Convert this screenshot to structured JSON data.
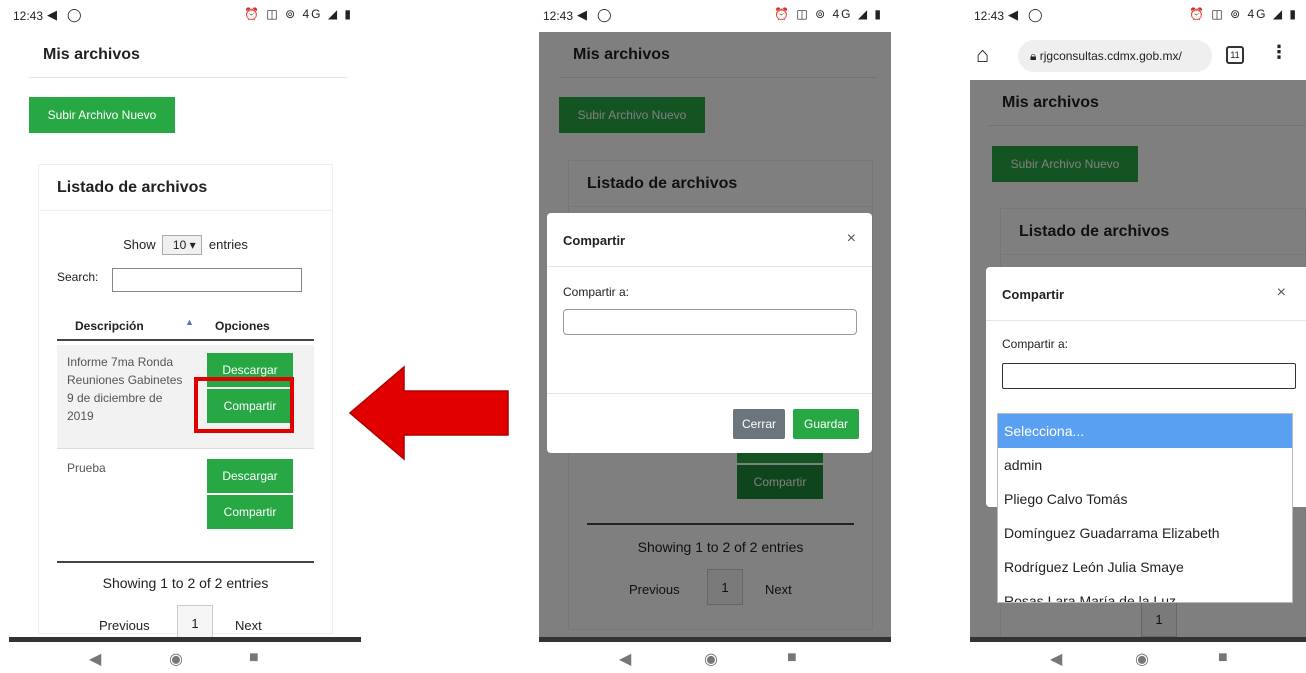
{
  "status": {
    "time": "12:43",
    "icons_right": "⏰ ◫ ⊚ 4G ◢ ▮"
  },
  "page": {
    "title": "Mis archivos",
    "upload_button": "Subir Archivo Nuevo",
    "list_title": "Listado de archivos",
    "show_label": "Show",
    "entries_value": "10 ▾",
    "entries_label": "entries",
    "search_label": "Search:",
    "columns": [
      "Descripción",
      "Opciones"
    ],
    "rows": [
      {
        "description": "Informe 7ma Ronda Reuniones Gabinetes 9 de diciembre de 2019",
        "download": "Descargar",
        "share": "Compartir"
      },
      {
        "description": "Prueba",
        "download": "Descargar",
        "share": "Compartir"
      }
    ],
    "showing": "Showing 1 to 2 of 2 entries",
    "pager": {
      "previous": "Previous",
      "current": "1",
      "next": "Next"
    }
  },
  "modal": {
    "title": "Compartir",
    "close": "×",
    "field_label": "Compartir a:",
    "cancel": "Cerrar",
    "save": "Guardar"
  },
  "browser": {
    "url": "rjgconsultas.cdmx.gob.mx/",
    "tab_count": "11"
  },
  "dropdown": {
    "options": [
      "Selecciona...",
      "admin",
      "Pliego Calvo Tomás",
      "Domínguez Guadarrama Elizabeth",
      "Rodríguez León Julia Smaye",
      "Rosas Lara María de la Luz"
    ]
  },
  "colors": {
    "green": "#28a745",
    "grey": "#6c757d",
    "highlight_red": "#e00000",
    "dropdown_selected": "#5aa0f2"
  },
  "icons": [
    "telegram-icon",
    "whatsapp-icon",
    "alarm-icon",
    "vibrate-icon",
    "hotspot-icon",
    "signal-icon",
    "battery-icon",
    "back-icon",
    "home-circle-icon",
    "recents-icon",
    "home-icon",
    "lock-icon",
    "tabs-icon",
    "menu-dots-icon",
    "arrow-left-icon"
  ]
}
